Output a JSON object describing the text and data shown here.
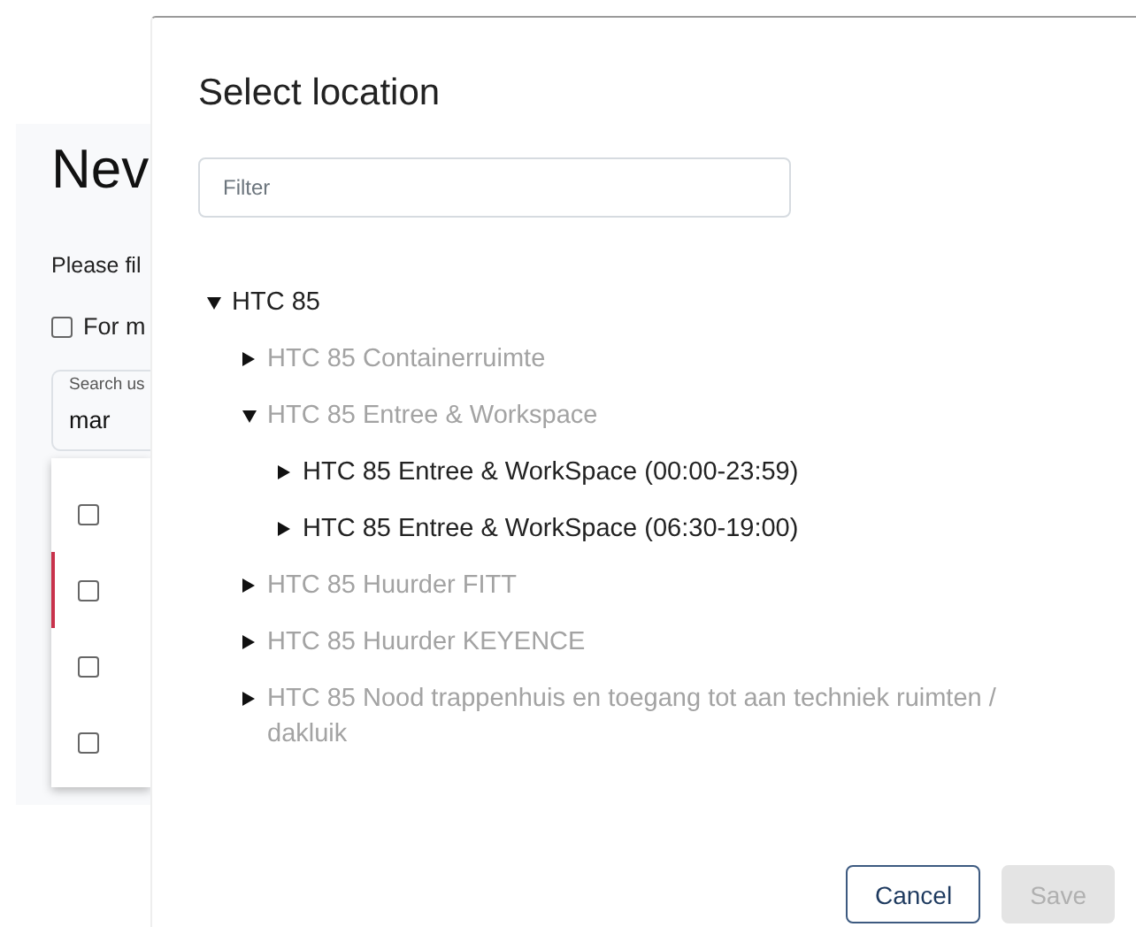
{
  "background_page": {
    "heading": "Nev",
    "intro": "Please fil",
    "for_me_checkbox": {
      "label": "For m",
      "checked": false
    },
    "search_field": {
      "label": "Search us",
      "value": "mar"
    },
    "results": [
      {
        "checked": false,
        "selected": false
      },
      {
        "checked": false,
        "selected": true
      },
      {
        "checked": false,
        "selected": false
      },
      {
        "checked": false,
        "selected": false
      }
    ]
  },
  "dialog": {
    "title": "Select location",
    "filter": {
      "placeholder": "Filter"
    },
    "tree": [
      {
        "label": "HTC 85",
        "expanded": true,
        "disabled": false,
        "children": [
          {
            "label": "HTC 85 Containerruimte",
            "expanded": false,
            "disabled": true
          },
          {
            "label": "HTC 85 Entree & Workspace",
            "expanded": true,
            "disabled": true,
            "children": [
              {
                "label": "HTC 85 Entree & WorkSpace (00:00-23:59)",
                "expanded": false,
                "disabled": false
              },
              {
                "label": "HTC 85 Entree & WorkSpace (06:30-19:00)",
                "expanded": false,
                "disabled": false
              }
            ]
          },
          {
            "label": "HTC 85 Huurder FITT",
            "expanded": false,
            "disabled": true
          },
          {
            "label": "HTC 85 Huurder KEYENCE",
            "expanded": false,
            "disabled": true
          },
          {
            "label": "HTC 85 Nood trappenhuis en toegang tot aan techniek ruimten / dakluik",
            "expanded": false,
            "disabled": true
          }
        ]
      }
    ],
    "buttons": [
      {
        "label": "Cancel",
        "disabled": false
      },
      {
        "label": "Save",
        "disabled": true
      }
    ]
  }
}
